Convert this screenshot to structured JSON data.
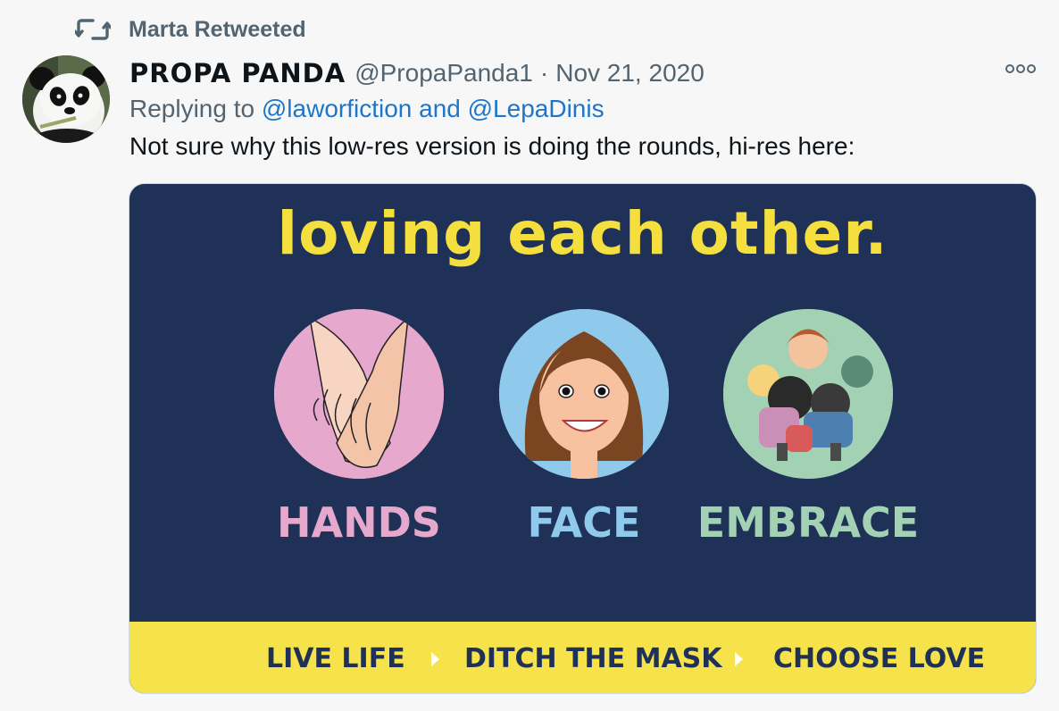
{
  "retweet": {
    "label": "Marta Retweeted",
    "icon": "retweet-icon"
  },
  "tweet": {
    "display_name": "PROPA PANDA",
    "handle": "@PropaPanda1",
    "separator": "·",
    "date": "Nov 21, 2020",
    "reply_prefix": "Replying to ",
    "reply_mentions": "@laworfiction and @LepaDinis",
    "text": "Not sure why this low-res version is doing the rounds, hi-res here:"
  },
  "media": {
    "headline": "loving each other.",
    "items": [
      {
        "caption": "HANDS",
        "color": "#e6a8cd"
      },
      {
        "caption": "FACE",
        "color": "#8fc9ec"
      },
      {
        "caption": "EMBRACE",
        "color": "#a3d1b4"
      }
    ],
    "slogans": [
      "LIVE LIFE",
      "DITCH THE MASK",
      "CHOOSE LOVE"
    ],
    "colors": {
      "background": "#1f3157",
      "headline": "#f4df3e",
      "bar": "#f6e24a"
    }
  },
  "colors": {
    "mention": "#1d76c7",
    "secondary_text": "#536471"
  }
}
